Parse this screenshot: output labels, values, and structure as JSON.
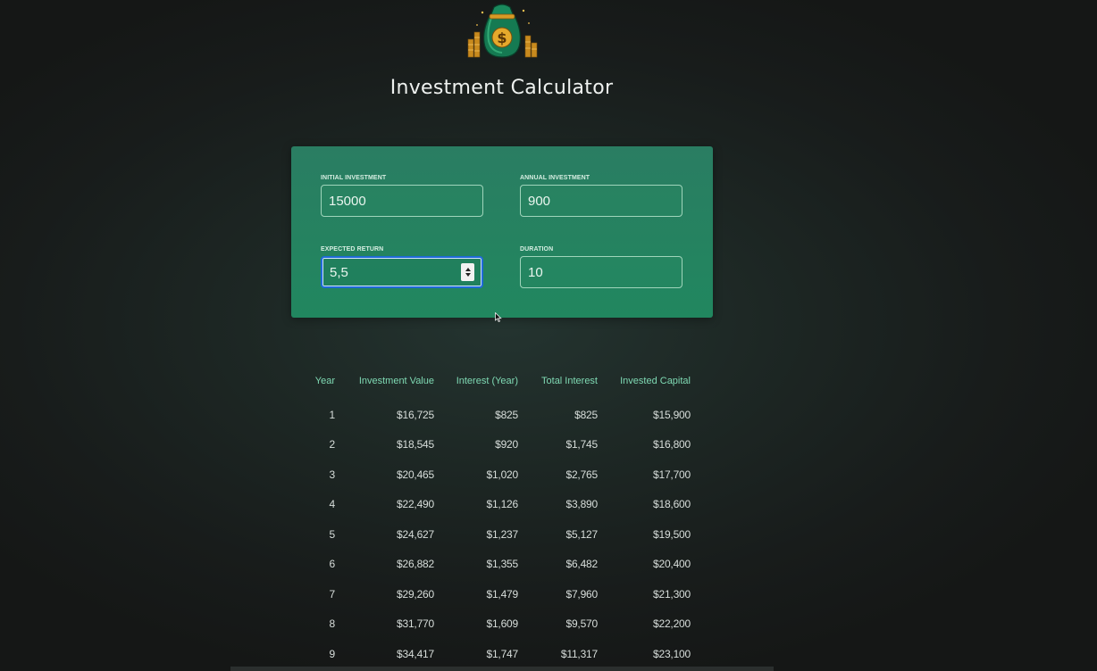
{
  "app": {
    "title": "Investment Calculator",
    "logo_icon": "money-bag-icon"
  },
  "inputs": {
    "initial_investment": {
      "label": "Initial Investment",
      "value": "15000"
    },
    "annual_investment": {
      "label": "Annual Investment",
      "value": "900"
    },
    "expected_return": {
      "label": "Expected Return",
      "value": "5,5"
    },
    "duration": {
      "label": "Duration",
      "value": "10"
    }
  },
  "table": {
    "headers": [
      "Year",
      "Investment Value",
      "Interest (Year)",
      "Total Interest",
      "Invested Capital"
    ],
    "rows": [
      [
        "1",
        "$16,725",
        "$825",
        "$825",
        "$15,900"
      ],
      [
        "2",
        "$18,545",
        "$920",
        "$1,745",
        "$16,800"
      ],
      [
        "3",
        "$20,465",
        "$1,020",
        "$2,765",
        "$17,700"
      ],
      [
        "4",
        "$22,490",
        "$1,126",
        "$3,890",
        "$18,600"
      ],
      [
        "5",
        "$24,627",
        "$1,237",
        "$5,127",
        "$19,500"
      ],
      [
        "6",
        "$26,882",
        "$1,355",
        "$6,482",
        "$20,400"
      ],
      [
        "7",
        "$29,260",
        "$1,479",
        "$7,960",
        "$21,300"
      ],
      [
        "8",
        "$31,770",
        "$1,609",
        "$9,570",
        "$22,200"
      ],
      [
        "9",
        "$34,417",
        "$1,747",
        "$11,317",
        "$23,100"
      ]
    ]
  },
  "colors": {
    "panel": "#21875f",
    "header_text": "#7fd9b3",
    "background": "#1d2724",
    "focus_border": "#1f6bd8"
  }
}
